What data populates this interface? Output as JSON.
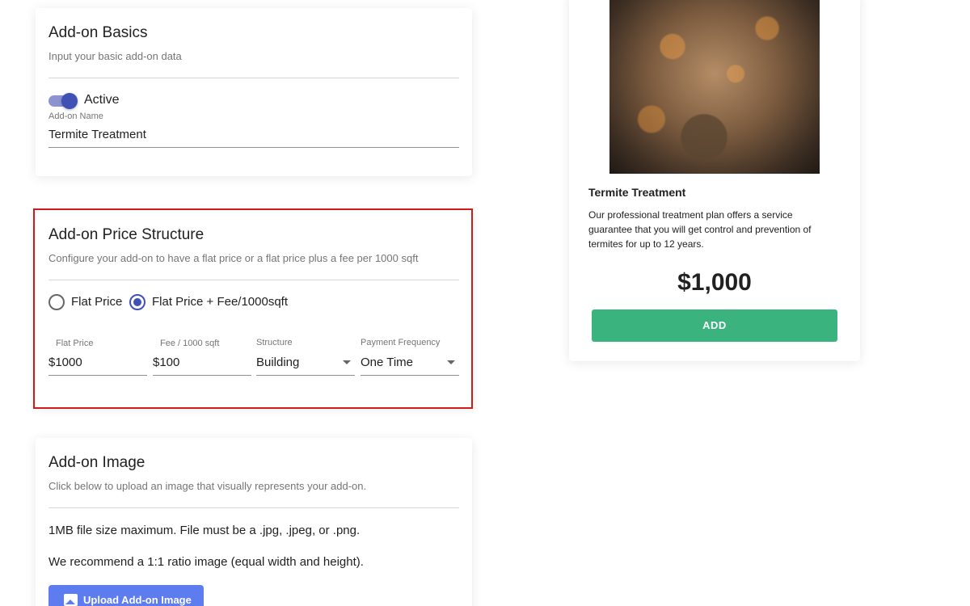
{
  "basics": {
    "title": "Add-on Basics",
    "subtitle": "Input your basic add-on data",
    "active_label": "Active",
    "active": true,
    "name_label": "Add-on Name",
    "name_value": "Termite Treatment"
  },
  "price": {
    "title": "Add-on Price Structure",
    "subtitle": "Configure your add-on to have a flat price or a flat price plus a fee per 1000 sqft",
    "options": [
      "Flat Price",
      "Flat Price + Fee/1000sqft"
    ],
    "selected_option": "Flat Price + Fee/1000sqft",
    "fields": {
      "flat_price": {
        "label": "Flat Price",
        "value": "$1000"
      },
      "fee": {
        "label": "Fee / 1000 sqft",
        "value": "$100"
      },
      "structure": {
        "label": "Structure",
        "value": "Building"
      },
      "frequency": {
        "label": "Payment Frequency",
        "value": "One Time"
      }
    },
    "highlight_color": "#d21a1a"
  },
  "image": {
    "title": "Add-on Image",
    "subtitle": "Click below to upload an image that visually represents your add-on.",
    "line1": "1MB file size maximum. File must be a .jpg, .jpeg, or .png.",
    "line2": "We recommend a 1:1 ratio image (equal width and height).",
    "upload_label": "Upload Add-on Image"
  },
  "preview": {
    "title": "Termite Treatment",
    "description": "Our professional treatment plan offers a service guarantee that you will get control and prevention of termites for up to 12 years.",
    "price": "$1,000",
    "add_label": "ADD",
    "add_color": "#3bb37e"
  },
  "colors": {
    "accent": "#3f51b5",
    "upload_button": "#5c7cf0"
  }
}
